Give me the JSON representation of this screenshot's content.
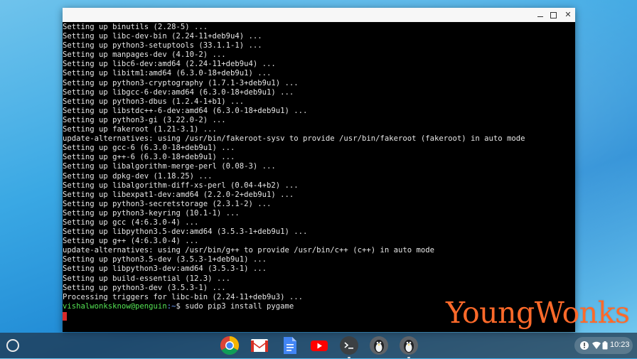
{
  "terminal": {
    "lines": [
      "Setting up binutils (2.28-5) ...",
      "Setting up libc-dev-bin (2.24-11+deb9u4) ...",
      "Setting up python3-setuptools (33.1.1-1) ...",
      "Setting up manpages-dev (4.10-2) ...",
      "Setting up libc6-dev:amd64 (2.24-11+deb9u4) ...",
      "Setting up libitm1:amd64 (6.3.0-18+deb9u1) ...",
      "Setting up python3-cryptography (1.7.1-3+deb9u1) ...",
      "Setting up libgcc-6-dev:amd64 (6.3.0-18+deb9u1) ...",
      "Setting up python3-dbus (1.2.4-1+b1) ...",
      "Setting up libstdc++-6-dev:amd64 (6.3.0-18+deb9u1) ...",
      "Setting up python3-gi (3.22.0-2) ...",
      "Setting up fakeroot (1.21-3.1) ...",
      "update-alternatives: using /usr/bin/fakeroot-sysv to provide /usr/bin/fakeroot (fakeroot) in auto mode",
      "Setting up gcc-6 (6.3.0-18+deb9u1) ...",
      "Setting up g++-6 (6.3.0-18+deb9u1) ...",
      "Setting up libalgorithm-merge-perl (0.08-3) ...",
      "Setting up dpkg-dev (1.18.25) ...",
      "Setting up libalgorithm-diff-xs-perl (0.04-4+b2) ...",
      "Setting up libexpat1-dev:amd64 (2.2.0-2+deb9u1) ...",
      "Setting up python3-secretstorage (2.3.1-2) ...",
      "Setting up python3-keyring (10.1-1) ...",
      "Setting up gcc (4:6.3.0-4) ...",
      "Setting up libpython3.5-dev:amd64 (3.5.3-1+deb9u1) ...",
      "Setting up g++ (4:6.3.0-4) ...",
      "update-alternatives: using /usr/bin/g++ to provide /usr/bin/c++ (c++) in auto mode",
      "Setting up python3.5-dev (3.5.3-1+deb9u1) ...",
      "Setting up libpython3-dev:amd64 (3.5.3-1) ...",
      "Setting up build-essential (12.3) ...",
      "Setting up python3-dev (3.5.3-1) ...",
      "Processing triggers for libc-bin (2.24-11+deb9u3) ..."
    ],
    "prompt_user": "vishalwonksknow@penguin",
    "prompt_path": ":~",
    "prompt_symbol": "$ ",
    "command": "sudo pip3 install pygame"
  },
  "watermark": "YoungWonks",
  "shelf": {
    "apps": [
      {
        "name": "chrome-icon"
      },
      {
        "name": "gmail-icon"
      },
      {
        "name": "docs-icon"
      },
      {
        "name": "youtube-icon"
      },
      {
        "name": "terminal-icon"
      },
      {
        "name": "linux-penguin-icon"
      },
      {
        "name": "linux-penguin-icon-2"
      }
    ],
    "time": "10:23"
  },
  "colors": {
    "terminal_bg": "#000000",
    "prompt_user": "#54e354",
    "prompt_path": "#6ea0ff",
    "cursor": "#d82a2a",
    "watermark": "#ff6a2a"
  }
}
